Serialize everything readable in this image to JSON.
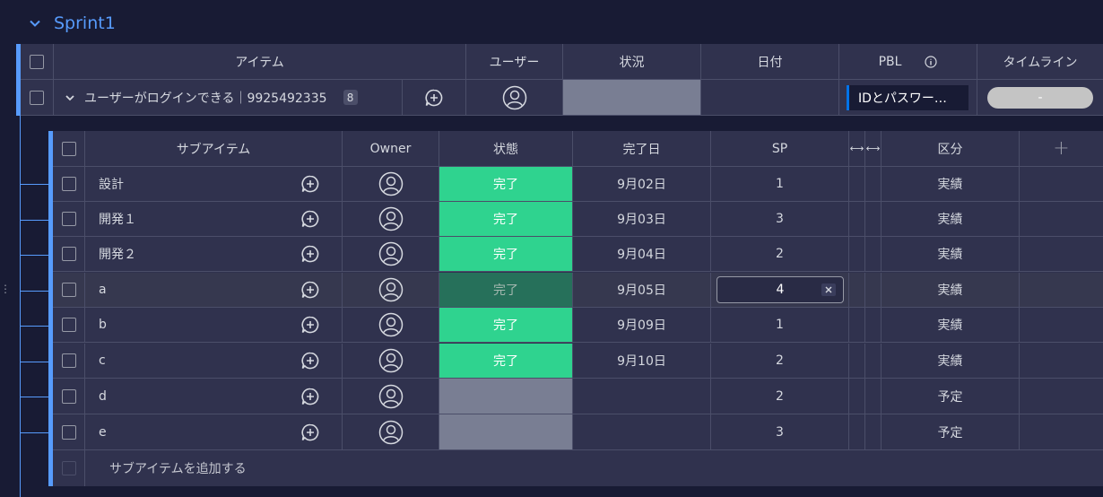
{
  "group": {
    "title": "Sprint1"
  },
  "main_table": {
    "headers": {
      "item": "アイテム",
      "user": "ユーザー",
      "status": "状況",
      "date": "日付",
      "pbl": "PBL",
      "timeline": "タイムライン"
    },
    "row": {
      "name": "ユーザーがログインできる｜9925492335",
      "subitem_count": "8",
      "pbl": "IDとパスワー…",
      "timeline": "-"
    }
  },
  "sub_table": {
    "headers": {
      "subitem": "サブアイテム",
      "owner": "Owner",
      "status": "状態",
      "done_date": "完了日",
      "sp": "SP",
      "category": "区分"
    },
    "rows": [
      {
        "name": "設計",
        "status": "完了",
        "date": "9月02日",
        "sp": "1",
        "category": "実績"
      },
      {
        "name": "開発１",
        "status": "完了",
        "date": "9月03日",
        "sp": "3",
        "category": "実績"
      },
      {
        "name": "開発２",
        "status": "完了",
        "date": "9月04日",
        "sp": "2",
        "category": "実績"
      },
      {
        "name": "a",
        "status": "完了",
        "date": "9月05日",
        "sp": "4",
        "category": "実績"
      },
      {
        "name": "b",
        "status": "完了",
        "date": "9月09日",
        "sp": "1",
        "category": "実績"
      },
      {
        "name": "c",
        "status": "完了",
        "date": "9月10日",
        "sp": "2",
        "category": "実績"
      },
      {
        "name": "d",
        "status": "",
        "date": "",
        "sp": "2",
        "category": "予定"
      },
      {
        "name": "e",
        "status": "",
        "date": "",
        "sp": "3",
        "category": "予定"
      }
    ],
    "add_label": "サブアイテムを追加する"
  },
  "colors": {
    "accent": "#579bfc",
    "done": "#2fd38f",
    "empty_status": "#797e93",
    "background": "#181b34",
    "table_bg": "#30324e"
  }
}
